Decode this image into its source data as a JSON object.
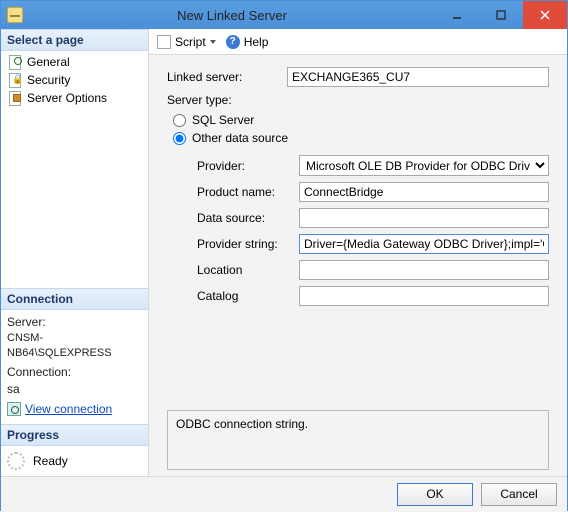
{
  "window": {
    "title": "New Linked Server"
  },
  "sidebar": {
    "select_page_header": "Select a page",
    "items": [
      {
        "label": "General"
      },
      {
        "label": "Security"
      },
      {
        "label": "Server Options"
      }
    ],
    "connection": {
      "header": "Connection",
      "server_label": "Server:",
      "server_value": "CNSM-NB64\\SQLEXPRESS",
      "connection_label": "Connection:",
      "connection_value": "sa",
      "view_link": "View connection "
    },
    "progress": {
      "header": "Progress",
      "status": "Ready"
    }
  },
  "toolbar": {
    "script": "Script",
    "help": "Help"
  },
  "form": {
    "linked_server_label": "Linked server:",
    "linked_server_value": "EXCHANGE365_CU7",
    "server_type_label": "Server type:",
    "radio_sql": "SQL Server",
    "radio_other": "Other data source",
    "provider_label": "Provider:",
    "provider_value": "Microsoft OLE DB Provider for ODBC Drivers",
    "product_label": "Product name:",
    "product_value": "ConnectBridge",
    "datasource_label": "Data source:",
    "datasource_value": "",
    "providerstr_label": "Provider string:",
    "providerstr_value": "Driver={Media Gateway ODBC Driver};impl='CORE",
    "location_label": "Location",
    "location_value": "",
    "catalog_label": "Catalog",
    "catalog_value": ""
  },
  "help_text": "ODBC connection string.",
  "footer": {
    "ok": "OK",
    "cancel": "Cancel"
  }
}
